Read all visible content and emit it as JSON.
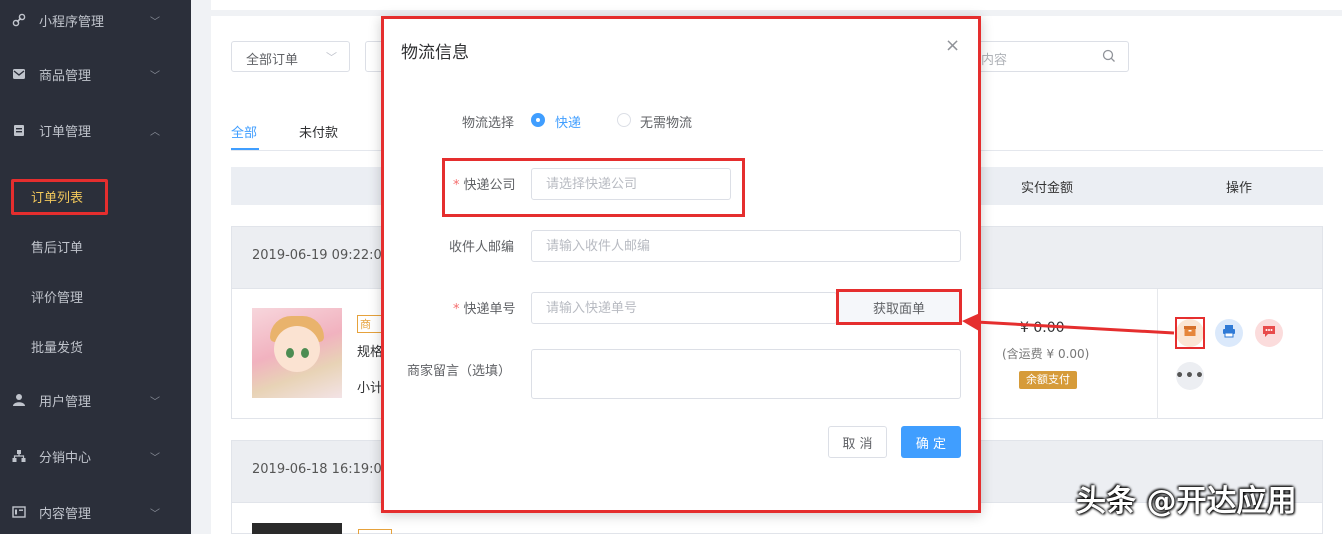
{
  "sidebar": {
    "items": [
      {
        "label": "小程序管理",
        "icon": "link-icon"
      },
      {
        "label": "商品管理",
        "icon": "mail-icon"
      },
      {
        "label": "订单管理",
        "icon": "clipboard-icon"
      },
      {
        "label": "用户管理",
        "icon": "user-icon"
      },
      {
        "label": "分销中心",
        "icon": "org-chart-icon"
      },
      {
        "label": "内容管理",
        "icon": "content-icon"
      }
    ],
    "sub_items": [
      {
        "label": "订单列表",
        "active": true
      },
      {
        "label": "售后订单"
      },
      {
        "label": "评价管理"
      },
      {
        "label": "批量发货"
      }
    ]
  },
  "filters": {
    "order_type": "全部订单",
    "search_placeholder": "内容"
  },
  "tabs": [
    {
      "label": "全部",
      "active": true
    },
    {
      "label": "未付款"
    }
  ],
  "table": {
    "headers": {
      "paid_amount": "实付金额",
      "actions": "操作"
    },
    "orders": [
      {
        "datetime": "2019-06-19 09:22:0",
        "tag": "商",
        "spec": "规格",
        "subtotal": "小计",
        "price": "¥ 0.00",
        "shipping": "(含运费 ¥ 0.00)",
        "pay_method": "余额支付"
      },
      {
        "datetime": "2019-06-18 16:19:0"
      }
    ]
  },
  "modal": {
    "title": "物流信息",
    "logistics_label": "物流选择",
    "option_express": "快递",
    "option_none": "无需物流",
    "company_label": "快递公司",
    "company_placeholder": "请选择快递公司",
    "zipcode_label": "收件人邮编",
    "zipcode_placeholder": "请输入收件人邮编",
    "tracking_label": "快递单号",
    "tracking_placeholder": "请输入快递单号",
    "get_waybill": "获取面单",
    "remark_label": "商家留言（选填）",
    "cancel": "取 消",
    "confirm": "确 定",
    "close_symbol": "×"
  },
  "watermark": "头条 @开达应用",
  "colors": {
    "primary": "#409eff",
    "annotation_red": "#e52e2e",
    "sidebar_bg": "#2b2f3a",
    "active_menu": "#f2c85b"
  }
}
